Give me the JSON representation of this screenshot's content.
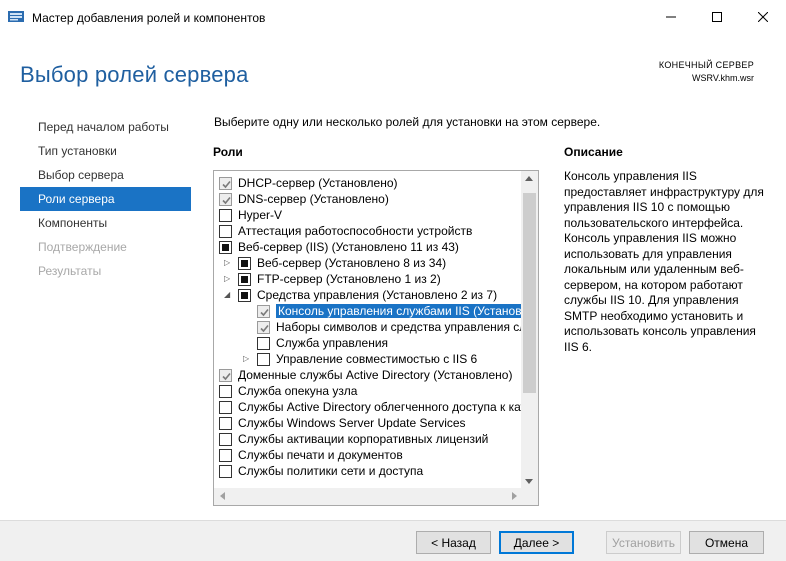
{
  "window": {
    "title": "Мастер добавления ролей и компонентов",
    "controls": [
      "minimize-icon",
      "maximize-icon",
      "close-icon"
    ]
  },
  "header": {
    "title": "Выбор ролей сервера",
    "server_label": "КОНЕЧНЫЙ СЕРВЕР",
    "server_name": "WSRV.khm.wsr"
  },
  "nav": {
    "items": [
      {
        "label": "Перед началом работы",
        "state": "normal"
      },
      {
        "label": "Тип установки",
        "state": "normal"
      },
      {
        "label": "Выбор сервера",
        "state": "normal"
      },
      {
        "label": "Роли сервера",
        "state": "active"
      },
      {
        "label": "Компоненты",
        "state": "normal"
      },
      {
        "label": "Подтверждение",
        "state": "disabled"
      },
      {
        "label": "Результаты",
        "state": "disabled"
      }
    ]
  },
  "main": {
    "instruction": "Выберите одну или несколько ролей для установки на этом сервере.",
    "roles_heading": "Роли",
    "description_heading": "Описание",
    "description": "Консоль управления IIS предоставляет инфраструктуру для управления IIS 10 с помощью пользовательского интерфейса. Консоль управления IIS можно использовать для управления локальным или удаленным веб-сервером, на котором работают службы IIS 10. Для управления SMTP необходимо установить и использовать консоль управления IIS 6.",
    "roles": [
      {
        "label": "DHCP-сервер (Установлено)",
        "level": 0,
        "check": "installed",
        "arrow": ""
      },
      {
        "label": "DNS-сервер (Установлено)",
        "level": 0,
        "check": "installed",
        "arrow": ""
      },
      {
        "label": "Hyper-V",
        "level": 0,
        "check": "none",
        "arrow": ""
      },
      {
        "label": "Аттестация работоспособности устройств",
        "level": 0,
        "check": "none",
        "arrow": ""
      },
      {
        "label": "Веб-сервер (IIS) (Установлено 11 из 43)",
        "level": 0,
        "check": "partial",
        "arrow": "expanded"
      },
      {
        "label": "Веб-сервер (Установлено 8 из 34)",
        "level": 1,
        "check": "partial",
        "arrow": "collapsed"
      },
      {
        "label": "FTP-сервер (Установлено 1 из 2)",
        "level": 1,
        "check": "partial",
        "arrow": "collapsed"
      },
      {
        "label": "Средства управления (Установлено 2 из 7)",
        "level": 1,
        "check": "partial",
        "arrow": "expanded"
      },
      {
        "label": "Консоль управления службами IIS (Установлено)",
        "level": 2,
        "check": "installed",
        "arrow": "",
        "selected": true
      },
      {
        "label": "Наборы символов и средства управления службами IIS",
        "level": 2,
        "check": "installed",
        "arrow": ""
      },
      {
        "label": "Служба управления",
        "level": 2,
        "check": "none",
        "arrow": ""
      },
      {
        "label": "Управление совместимостью с IIS 6",
        "level": 2,
        "check": "none",
        "arrow": "collapsed"
      },
      {
        "label": "Доменные службы Active Directory (Установлено)",
        "level": 0,
        "check": "installed",
        "arrow": ""
      },
      {
        "label": "Служба опекуна узла",
        "level": 0,
        "check": "none",
        "arrow": ""
      },
      {
        "label": "Службы Active Directory облегченного доступа к каталогам",
        "level": 0,
        "check": "none",
        "arrow": ""
      },
      {
        "label": "Службы Windows Server Update Services",
        "level": 0,
        "check": "none",
        "arrow": ""
      },
      {
        "label": "Службы активации корпоративных лицензий",
        "level": 0,
        "check": "none",
        "arrow": ""
      },
      {
        "label": "Службы печати и документов",
        "level": 0,
        "check": "none",
        "arrow": ""
      },
      {
        "label": "Службы политики сети и доступа",
        "level": 0,
        "check": "none",
        "arrow": ""
      }
    ]
  },
  "footer": {
    "back": "< Назад",
    "next": "Далее >",
    "install": "Установить",
    "cancel": "Отмена"
  },
  "colors": {
    "accent": "#1a73c5",
    "title": "#1f5fa0",
    "disabled_text": "#a8a8a8"
  }
}
